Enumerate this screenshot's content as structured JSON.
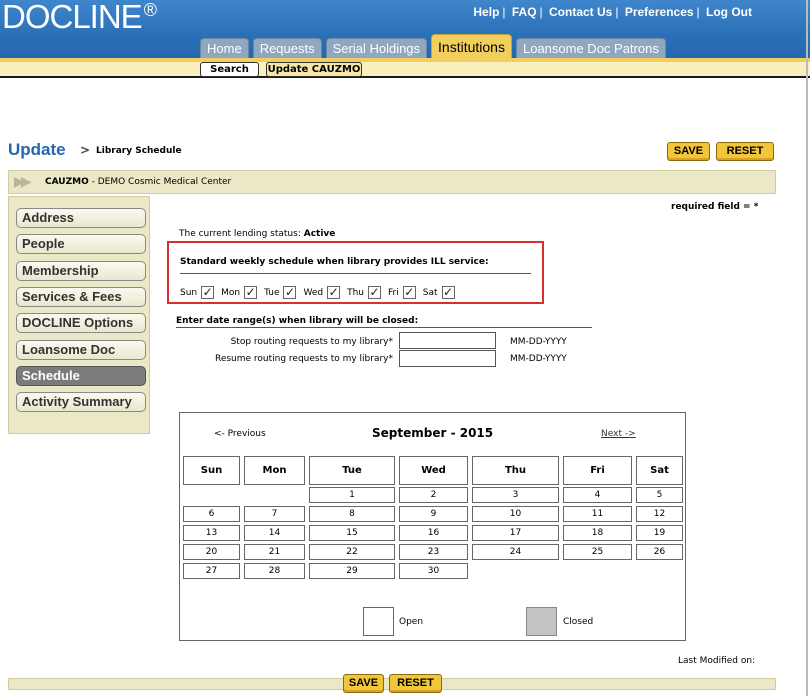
{
  "app": {
    "logo": "DOCLINE",
    "logo_mark": "®"
  },
  "top_links": [
    "Help",
    "FAQ",
    "Contact Us",
    "Preferences",
    "Log Out"
  ],
  "tabs": [
    {
      "label": "Home",
      "active": false
    },
    {
      "label": "Requests",
      "active": false
    },
    {
      "label": "Serial Holdings",
      "active": false
    },
    {
      "label": "Institutions",
      "active": true
    },
    {
      "label": "Loansome Doc Patrons",
      "active": false
    }
  ],
  "subnav": {
    "search": "Search",
    "update": "Update CAUZMO"
  },
  "page": {
    "title": "Update",
    "arrow": ">",
    "subtitle": "Library Schedule",
    "save": "SAVE",
    "reset": "RESET"
  },
  "institution": {
    "code": "CAUZMO",
    "separator": " - ",
    "name": "DEMO Cosmic Medical Center"
  },
  "sidebar": {
    "items": [
      {
        "label": "Address",
        "active": false
      },
      {
        "label": "People",
        "active": false
      },
      {
        "label": "Membership",
        "active": false
      },
      {
        "label": "Services & Fees",
        "active": false
      },
      {
        "label": "DOCLINE Options",
        "active": false
      },
      {
        "label": "Loansome Doc",
        "active": false
      },
      {
        "label": "Schedule",
        "active": true
      },
      {
        "label": "Activity Summary",
        "active": false
      }
    ]
  },
  "form": {
    "required_note": "required field = *",
    "lending_status_label": "The current lending status:",
    "lending_status_value": "Active",
    "schedule_heading": "Standard weekly schedule when library provides ILL service:",
    "days": [
      {
        "label": "Sun",
        "checked": true
      },
      {
        "label": "Mon",
        "checked": true
      },
      {
        "label": "Tue",
        "checked": true
      },
      {
        "label": "Wed",
        "checked": true
      },
      {
        "label": "Thu",
        "checked": true
      },
      {
        "label": "Fri",
        "checked": true
      },
      {
        "label": "Sat",
        "checked": true
      }
    ],
    "closed_heading": "Enter date range(s) when library will be closed:",
    "stop_label": "Stop routing requests to my library*",
    "stop_value": "",
    "resume_label": "Resume routing requests to my library*",
    "resume_value": "",
    "date_format": "MM-DD-YYYY"
  },
  "calendar": {
    "prev": "<- Previous",
    "month": "September - 2015",
    "next": "Next ->",
    "weekdays": [
      "Sun",
      "Mon",
      "Tue",
      "Wed",
      "Thu",
      "Fri",
      "Sat"
    ],
    "weeks": [
      [
        "",
        "",
        "1",
        "2",
        "3",
        "4",
        "5"
      ],
      [
        "6",
        "7",
        "8",
        "9",
        "10",
        "11",
        "12"
      ],
      [
        "13",
        "14",
        "15",
        "16",
        "17",
        "18",
        "19"
      ],
      [
        "20",
        "21",
        "22",
        "23",
        "24",
        "25",
        "26"
      ],
      [
        "27",
        "28",
        "29",
        "30",
        "",
        "",
        ""
      ]
    ],
    "legend_open": "Open",
    "legend_closed": "Closed"
  },
  "footer": {
    "last_modified_label": "Last Modified on:"
  },
  "colors": {
    "header_blue": "#2a6fb6",
    "accent_gold": "#f2c63a",
    "highlight_red": "#d9302c",
    "closed_gray": "#c3c3c3"
  }
}
